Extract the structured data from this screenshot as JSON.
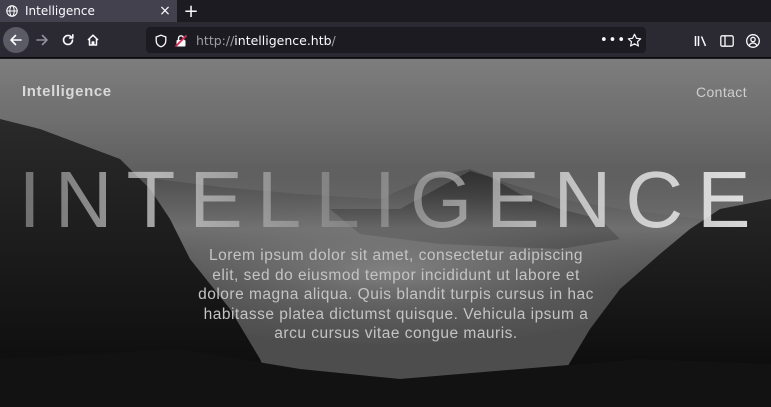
{
  "browser": {
    "tab": {
      "title": "Intelligence",
      "close_label": "×"
    },
    "new_tab_label": "+",
    "url": {
      "scheme": "http://",
      "host": "intelligence.htb",
      "path": "/"
    },
    "more_label": "•••"
  },
  "site": {
    "brand": "Intelligence",
    "nav_contact": "Contact",
    "hero_title": "INTELLIGENCE",
    "hero_text": "Lorem ipsum dolor sit amet, consectetur adipiscing elit, sed do eiusmod tempor incididunt ut labore et dolore magna aliqua. Quis blandit turpis cursus in hac habitasse platea dictumst quisque. Vehicula ipsum a arcu cursus vitae congue mauris."
  },
  "icons": {
    "tab": "globe-icon",
    "back": "back-arrow-icon",
    "forward": "forward-arrow-icon",
    "reload": "reload-icon",
    "home": "home-icon",
    "shield": "tracking-protection-shield-icon",
    "lock": "insecure-lock-icon",
    "bookmark": "star-icon",
    "library": "library-icon",
    "sidebar": "sidebar-icon",
    "account": "account-icon"
  },
  "colors": {
    "chrome_bg": "#1c1b22",
    "toolbar_bg": "#2b2a33",
    "tab_active": "#42414d",
    "insecure_accent": "#e22850"
  }
}
